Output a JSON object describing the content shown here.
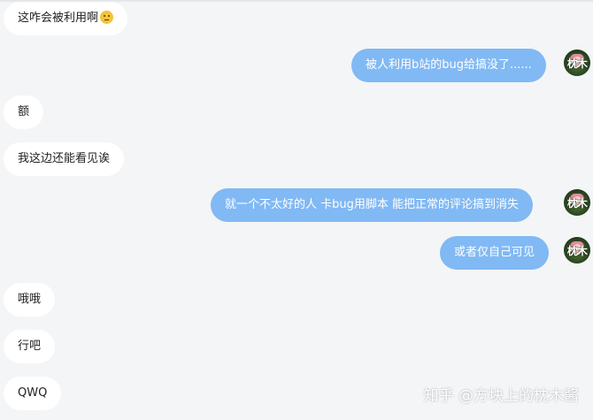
{
  "messages": [
    {
      "side": "in",
      "text": "这咋会被利用啊",
      "emoji": "thinking-face-icon"
    },
    {
      "side": "out",
      "text": "被人利用b站的bug给搞没了......",
      "avatar_text": "枕木"
    },
    {
      "side": "in",
      "text": "额"
    },
    {
      "side": "in",
      "text": "我这边还能看见诶"
    },
    {
      "side": "out",
      "text": "就一个不太好的人 卡bug用脚本 能把正常的评论搞到消失",
      "avatar_text": "枕木"
    },
    {
      "side": "out",
      "text": "或者仅自己可见",
      "avatar_text": "枕木"
    },
    {
      "side": "in",
      "text": "哦哦"
    },
    {
      "side": "in",
      "text": "行吧"
    },
    {
      "side": "in",
      "text": "QWQ"
    }
  ],
  "watermark": "知乎 @方块上的枕木酱",
  "colors": {
    "background": "#f4f5f7",
    "incoming": "#ffffff",
    "outgoing": "#81b9f4"
  }
}
